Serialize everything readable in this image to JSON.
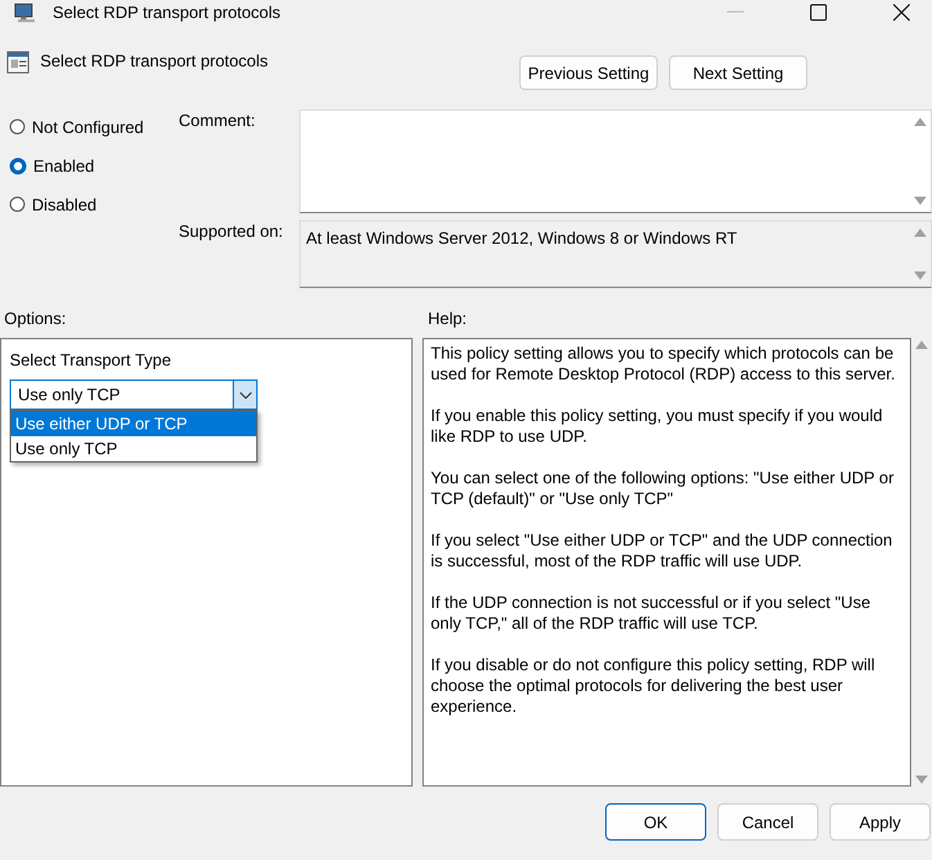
{
  "window": {
    "title": "Select RDP transport protocols"
  },
  "header": {
    "title": "Select RDP transport protocols",
    "buttons": [
      "Previous Setting",
      "Next Setting"
    ]
  },
  "state_options": [
    {
      "label": "Not Configured",
      "selected": false
    },
    {
      "label": "Enabled",
      "selected": true
    },
    {
      "label": "Disabled",
      "selected": false
    }
  ],
  "comment": {
    "label": "Comment:"
  },
  "supported_on": {
    "label": "Supported on:",
    "value": "At least Windows Server 2012, Windows 8 or Windows RT"
  },
  "options": {
    "label": "Options:",
    "field_label": "Select Transport Type",
    "dropdown": {
      "value": "Use only TCP",
      "expanded": true,
      "items": [
        {
          "label": "Use either UDP or TCP",
          "highlighted": true
        },
        {
          "label": "Use only TCP",
          "highlighted": false
        }
      ]
    }
  },
  "help": {
    "label": "Help:",
    "paragraphs": [
      "This policy setting allows you to specify which protocols can be used for Remote Desktop Protocol (RDP) access to this server.",
      "If you enable this policy setting, you must specify if you would like RDP to use UDP.",
      "You can select one of the following options: \"Use either UDP or TCP (default)\" or \"Use only TCP\"",
      "If you select \"Use either UDP or TCP\" and the UDP connection is successful, most of the RDP traffic will use UDP.",
      "If the UDP connection is not successful or if you select \"Use only TCP,\" all of the RDP traffic will use TCP.",
      "If you disable or do not configure this policy setting, RDP will choose the optimal protocols for delivering the best user experience."
    ]
  },
  "buttons": [
    {
      "label": "OK",
      "focused": true
    },
    {
      "label": "Cancel",
      "focused": false
    },
    {
      "label": "Apply",
      "focused": false
    }
  ]
}
